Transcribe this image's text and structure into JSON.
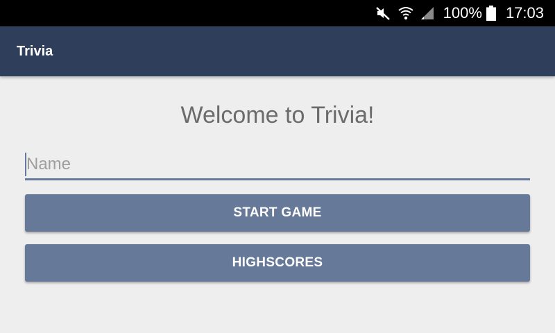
{
  "status_bar": {
    "battery_percent": "100%",
    "time": "17:03",
    "icons": [
      "mute-icon",
      "wifi-icon",
      "signal-icon",
      "battery-icon"
    ]
  },
  "app_bar": {
    "title": "Trivia",
    "color": "#2f3e5a"
  },
  "main": {
    "welcome_text": "Welcome to Trivia!",
    "name_input": {
      "value": "",
      "placeholder": "Name"
    },
    "start_button_label": "START GAME",
    "highscores_button_label": "HIGHSCORES",
    "button_color": "#667999"
  }
}
